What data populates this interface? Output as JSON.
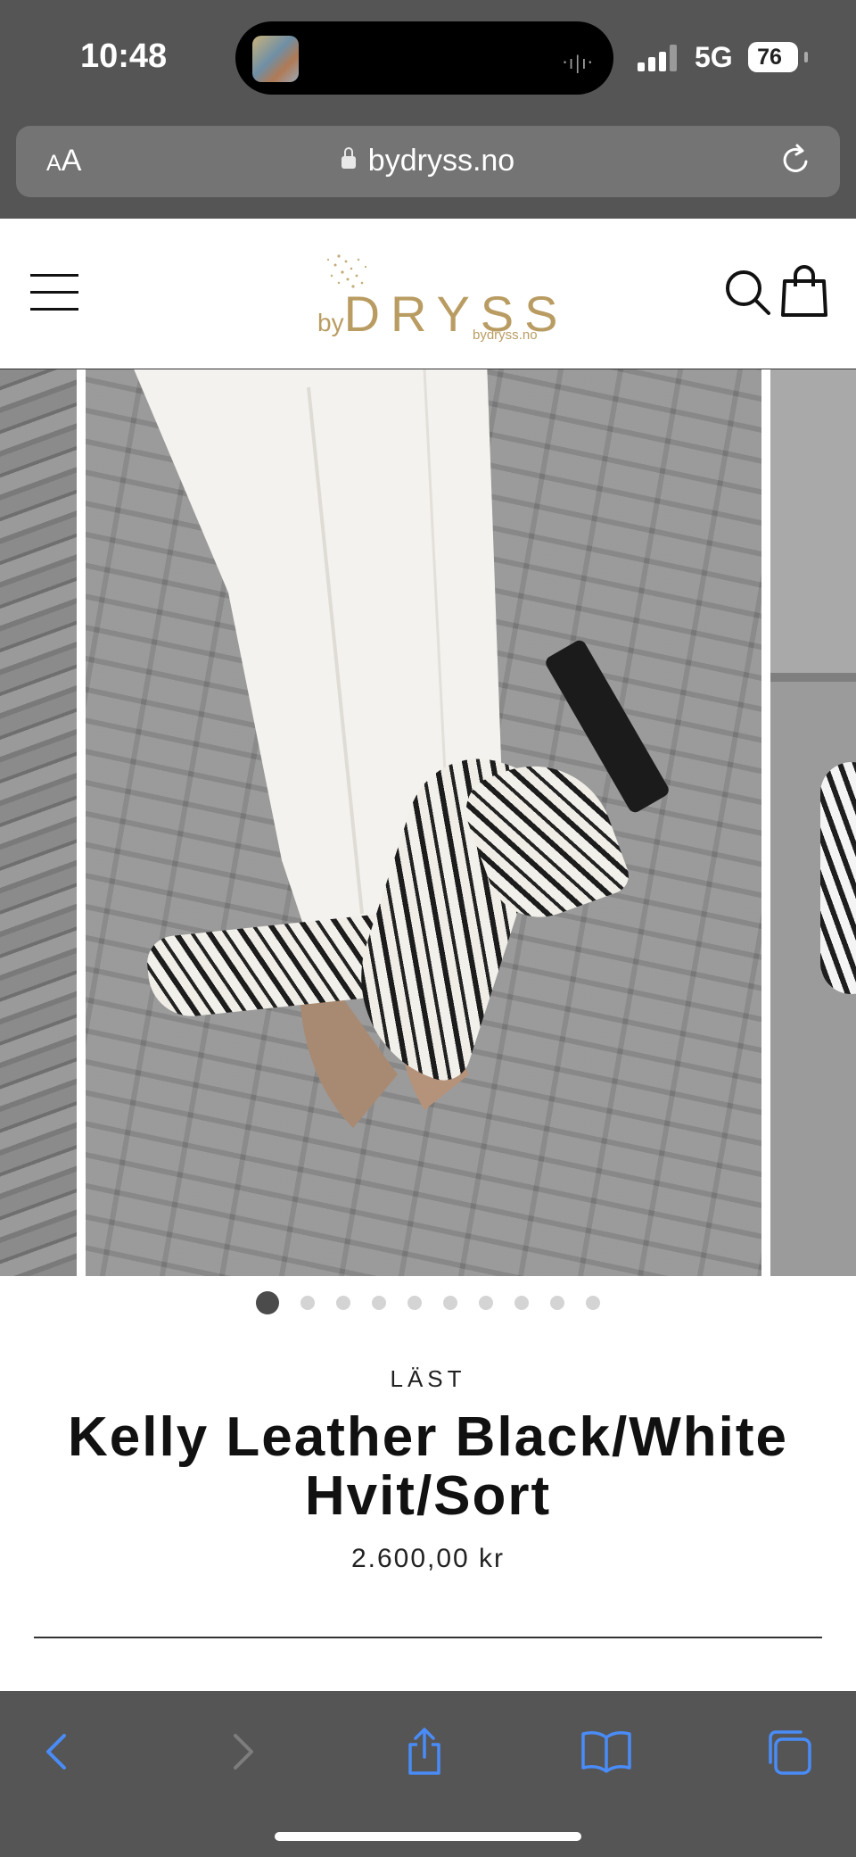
{
  "status_bar": {
    "time": "10:48",
    "network": "5G",
    "battery": "76"
  },
  "browser": {
    "text_size_label_small": "A",
    "text_size_label_large": "A",
    "url": "bydryss.no"
  },
  "site": {
    "logo_by": "by",
    "logo_name": "DRYSS",
    "logo_sub": "bydryss.no"
  },
  "gallery": {
    "dot_count": 10,
    "active_index": 0
  },
  "product": {
    "vendor": "LÄST",
    "title": "Kelly Leather Black/White Hvit/Sort",
    "price": "2.600,00 kr"
  },
  "colors": {
    "chrome": "#555555",
    "brand_gold": "#b99c62",
    "ios_blue": "#4a8cf7"
  }
}
